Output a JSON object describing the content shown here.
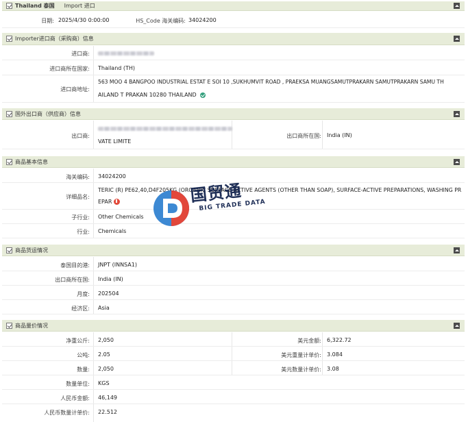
{
  "header": {
    "country": "Thailand 泰国",
    "direction": "Import 进口",
    "date_label": "日期:",
    "date_value": "2025/4/30 0:00:00",
    "hs_label": "HS_Code 海关编码:",
    "hs_value": "34024200"
  },
  "importer": {
    "title": "Importer进口商（采购商）信息",
    "name_label": "进口商:",
    "country_label": "进口商所在国家:",
    "country_value": "Thailand (TH)",
    "address_label": "进口商地址:",
    "address_line1": "563 MOO 4 BANGPOO INDUSTRIAL ESTAT E SOI 10 ,SUKHUMVIT ROAD , PRAEKSA MUANGSAMUTPRAKARN SAMUTPRAKARN SAMU TH",
    "address_line2": "AILAND T PRAKAN 10280 THAILAND"
  },
  "exporter": {
    "title": "国外出口商（供应商）信息",
    "name_label": "出口商:",
    "name_tail": "VATE LIMITE",
    "country_label": "出口商所在国:",
    "country_value": "India (IN)"
  },
  "product": {
    "title": "商品基本信息",
    "hs_label": "海关编码:",
    "hs_value": "34024200",
    "desc_label": "详细品名:",
    "desc_line1": "TERIC (R) PE62,40,D4F205KG (ORGANIC SURFACE-ACTIVE AGENTS (OTHER THAN SOAP), SURFACE-ACTIVE PREPARATIONS, WASHING PR",
    "desc_line2": "EPAR",
    "sub_industry_label": "子行业:",
    "sub_industry_value": "Other Chemicals",
    "industry_label": "行业:",
    "industry_value": "Chemicals"
  },
  "shipping": {
    "title": "商品货运情况",
    "port_label": "泰国目的港:",
    "port_value": "JNPT (INNSA1)",
    "origin_label": "出口商所在国:",
    "origin_value": "India (IN)",
    "month_label": "月度:",
    "month_value": "202504",
    "region_label": "经济区:",
    "region_value": "Asia"
  },
  "price": {
    "title": "商品量价情况",
    "net_kg_label": "净重公斤:",
    "net_kg_value": "2,050",
    "usd_amount_label": "美元金额:",
    "usd_amount_value": "6,322.72",
    "ton_label": "公吨:",
    "ton_value": "2.05",
    "usd_weight_price_label": "美元重量计单价:",
    "usd_weight_price_value": "3.084",
    "qty_label": "数量:",
    "qty_value": "2,050",
    "usd_qty_price_label": "美元数量计单价:",
    "usd_qty_price_value": "3.08",
    "unit_label": "数量单位:",
    "unit_value": "KGS",
    "rmb_amount_label": "人民币金额:",
    "rmb_amount_value": "46,149",
    "rmb_qty_price_label": "人民币数量计单价:",
    "rmb_qty_price_value": "22.512"
  },
  "watermark": {
    "cn": "国贸通",
    "en": "BIG TRADE DATA",
    "colors": {
      "blue": "#2d7fd0",
      "red": "#e0382b",
      "navy": "#0e1f4a"
    }
  },
  "icons": {
    "section_checkbox": "checkbox-icon",
    "collapse": "collapse-icon",
    "address_verified": "verified-icon",
    "desc_info": "info-icon"
  }
}
